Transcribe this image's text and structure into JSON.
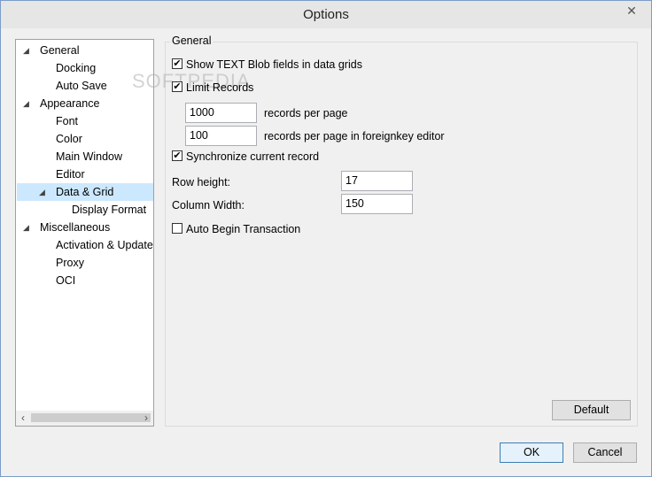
{
  "window": {
    "title": "Options",
    "close_glyph": "✕"
  },
  "watermark": "SOFTPEDIA",
  "tree": {
    "items": [
      {
        "label": "General",
        "expanded": true
      },
      {
        "label": "Docking"
      },
      {
        "label": "Auto Save"
      },
      {
        "label": "Appearance",
        "expanded": true
      },
      {
        "label": "Font"
      },
      {
        "label": "Color"
      },
      {
        "label": "Main Window"
      },
      {
        "label": "Editor"
      },
      {
        "label": "Data & Grid",
        "expanded": true,
        "selected": true
      },
      {
        "label": "Display Format"
      },
      {
        "label": "Miscellaneous",
        "expanded": true
      },
      {
        "label": "Activation & Updater"
      },
      {
        "label": "Proxy"
      },
      {
        "label": "OCI"
      }
    ],
    "expand_glyph": "◢",
    "scroll_left": "‹",
    "scroll_right": "›"
  },
  "general": {
    "title": "General",
    "show_text_blob": {
      "label": "Show TEXT Blob fields in data grids",
      "checked": true
    },
    "limit_records": {
      "label": "Limit Records",
      "checked": true
    },
    "records_per_page": {
      "value": "1000",
      "label": "records per page"
    },
    "records_per_page_fk": {
      "value": "100",
      "label": "records per page in foreignkey editor"
    },
    "sync_record": {
      "label": "Synchronize current record",
      "checked": true
    },
    "row_height": {
      "label": "Row height:",
      "value": "17"
    },
    "column_width": {
      "label": "Column Width:",
      "value": "150"
    },
    "auto_begin": {
      "label": "Auto Begin Transaction",
      "checked": false
    },
    "default_button": "Default"
  },
  "footer": {
    "ok": "OK",
    "cancel": "Cancel"
  },
  "check_glyph": "✔"
}
